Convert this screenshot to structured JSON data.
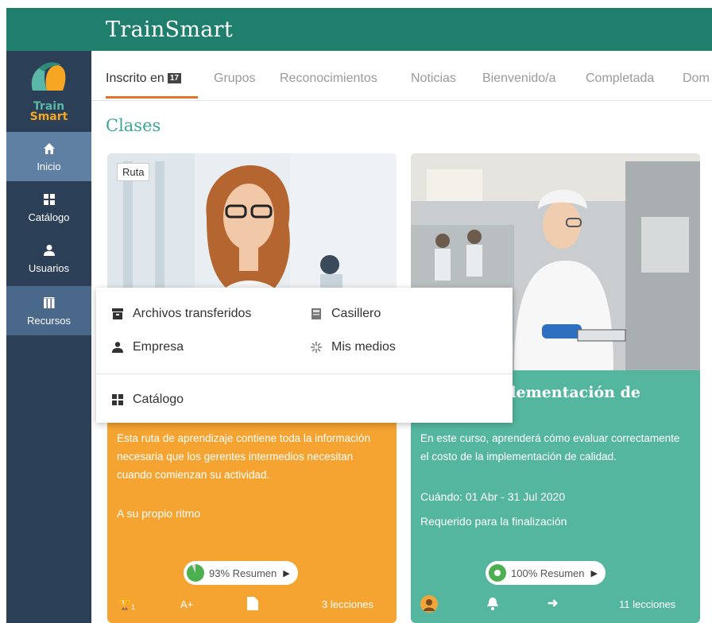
{
  "app": {
    "title": "TrainSmart"
  },
  "logo": {
    "line1": "Train",
    "line2": "Smart"
  },
  "sidebar": {
    "items": [
      {
        "label": "Inicio",
        "icon": "home-icon"
      },
      {
        "label": "Catálogo",
        "icon": "grid-icon"
      },
      {
        "label": "Usuarios",
        "icon": "user-icon"
      },
      {
        "label": "Recursos",
        "icon": "books-icon"
      }
    ]
  },
  "tabs": {
    "items": [
      {
        "label": "Inscrito en",
        "badge": "17"
      },
      {
        "label": "Grupos"
      },
      {
        "label": "Reconocimientos"
      },
      {
        "label": "Noticias"
      },
      {
        "label": "Bienvenido/a"
      },
      {
        "label": "Completada"
      },
      {
        "label": "Dom"
      }
    ]
  },
  "section": {
    "title": "Clases"
  },
  "dropdown": {
    "items": [
      {
        "label": "Archivos transferidos",
        "icon": "archive-icon"
      },
      {
        "label": "Casillero",
        "icon": "locker-icon"
      },
      {
        "label": "Empresa",
        "icon": "company-icon"
      },
      {
        "label": "Mis medios",
        "icon": "media-icon"
      },
      {
        "label": "Catálogo",
        "icon": "grid-icon"
      }
    ]
  },
  "cards": [
    {
      "tag": "Ruta",
      "description": "Esta ruta de aprendizaje contiene toda la información necesaria que los gerentes intermedios necesitan cuando comienzan su actividad.",
      "pace": "A su propio ritmo",
      "progress_label": "93% Resumen",
      "progress": 0.93,
      "footer": {
        "trophy_count": "1",
        "grade": "A+",
        "lessons": "3 lecciones"
      },
      "color": "#f5a331"
    },
    {
      "title": "plementación de",
      "description": "En este curso, aprenderá cómo evaluar correctamente el costo de la implementación de calidad.",
      "when": "Cuándo: 01 Abr - 31 Jul 2020",
      "required": "Requerido para la finalización",
      "progress_label": "100% Resumen",
      "progress": 1.0,
      "footer": {
        "lessons": "11 lecciones"
      },
      "color": "#55b6a0"
    }
  ]
}
